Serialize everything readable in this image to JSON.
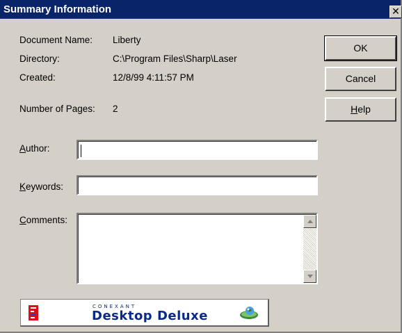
{
  "window": {
    "title": "Summary Information",
    "close_glyph": "✕"
  },
  "info": {
    "document_name_label": "Document Name:",
    "document_name_value": "Liberty",
    "directory_label": "Directory:",
    "directory_value": "C:\\Program Files\\Sharp\\Laser",
    "created_label": "Created:",
    "created_value": "12/8/99 4:11:57 PM",
    "pages_label": "Number of Pages:",
    "pages_value": "2"
  },
  "form": {
    "author_label_mnemonic": "A",
    "author_label_rest": "uthor:",
    "author_value": "",
    "keywords_label_mnemonic": "K",
    "keywords_label_rest": "eywords:",
    "keywords_value": "",
    "comments_label_mnemonic": "C",
    "comments_label_rest": "omments:",
    "comments_value": ""
  },
  "buttons": {
    "ok_label": "OK",
    "cancel_label": "Cancel",
    "help_mnemonic": "H",
    "help_rest": "elp"
  },
  "banner": {
    "brand": "CONEXANT",
    "product": "Desktop Deluxe"
  },
  "colors": {
    "titlebar": "#0a246a",
    "dialog_face": "#d4d0c8",
    "banner_text": "#0a2a8a"
  }
}
